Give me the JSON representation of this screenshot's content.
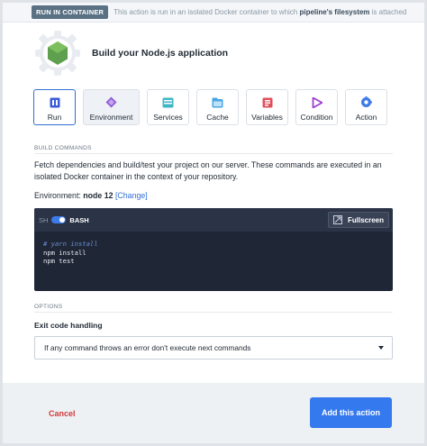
{
  "banner": {
    "tag": "RUN IN CONTAINER",
    "message_pre": "This action is run in an isolated Docker container to which ",
    "message_bold": "pipeline's filesystem",
    "message_post": " is attached"
  },
  "header": {
    "title": "Build your Node.js application"
  },
  "tabs": [
    {
      "label": "Run",
      "icon": "run-icon",
      "active": true
    },
    {
      "label": "Environment",
      "icon": "environment-icon",
      "active": false
    },
    {
      "label": "Services",
      "icon": "services-icon",
      "active": false
    },
    {
      "label": "Cache",
      "icon": "cache-icon",
      "active": false
    },
    {
      "label": "Variables",
      "icon": "variables-icon",
      "active": false
    },
    {
      "label": "Condition",
      "icon": "condition-icon",
      "active": false
    },
    {
      "label": "Action",
      "icon": "action-icon",
      "active": false
    }
  ],
  "build": {
    "section_label": "BUILD COMMANDS",
    "description": "Fetch dependencies and build/test your project on our server. These commands are executed in an isolated Docker container in the context of your repository.",
    "env_label": "Environment:",
    "env_value": "node 12",
    "env_change": "[Change]"
  },
  "editor": {
    "sh_label": "SH",
    "bash_label": "BASH",
    "fullscreen_label": "Fullscreen",
    "lines": [
      "# yarn install",
      "npm install",
      "npm test"
    ]
  },
  "options": {
    "section_label": "OPTIONS",
    "exit_label": "Exit code handling",
    "exit_value": "If any command throws an error don't execute next commands"
  },
  "footer": {
    "cancel_label": "Cancel",
    "add_label": "Add this action"
  },
  "colors": {
    "accent": "#3479ee",
    "danger": "#d33a3a",
    "editor_bg": "#1f2636",
    "node_green": "#5fa04e"
  }
}
